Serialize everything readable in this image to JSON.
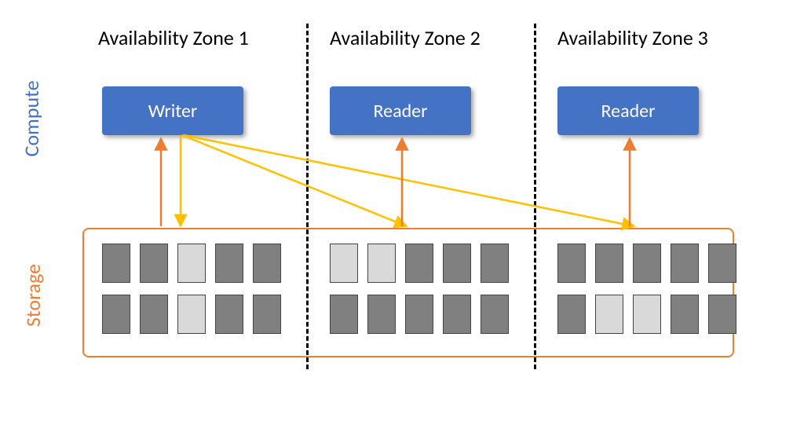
{
  "layers": {
    "compute": "Compute",
    "storage": "Storage"
  },
  "zones": [
    {
      "header": "Availability Zone 1",
      "node": "Writer"
    },
    {
      "header": "Availability Zone 2",
      "node": "Reader"
    },
    {
      "header": "Availability Zone 3",
      "node": "Reader"
    }
  ],
  "colors": {
    "node_fill": "#4472C4",
    "storage_border": "#ED7D31",
    "compute_label": "#4472C4",
    "storage_label": "#ED7D31",
    "write_arrow": "#FFC000",
    "read_arrow": "#ED7D31",
    "block_dark": "#808080",
    "block_light": "#D9D9D9"
  },
  "storage_blocks": {
    "rows": 2,
    "cols_per_zone": 5,
    "light_positions": {
      "zone1": [
        [
          0,
          2
        ],
        [
          1,
          2
        ]
      ],
      "zone2": [
        [
          0,
          0
        ],
        [
          0,
          1
        ]
      ],
      "zone3": [
        [
          1,
          1
        ],
        [
          1,
          2
        ]
      ]
    }
  },
  "arrows": {
    "writer_to_zones": [
      1,
      2,
      3
    ],
    "reader_up_from_zones": [
      1,
      2,
      3
    ]
  }
}
